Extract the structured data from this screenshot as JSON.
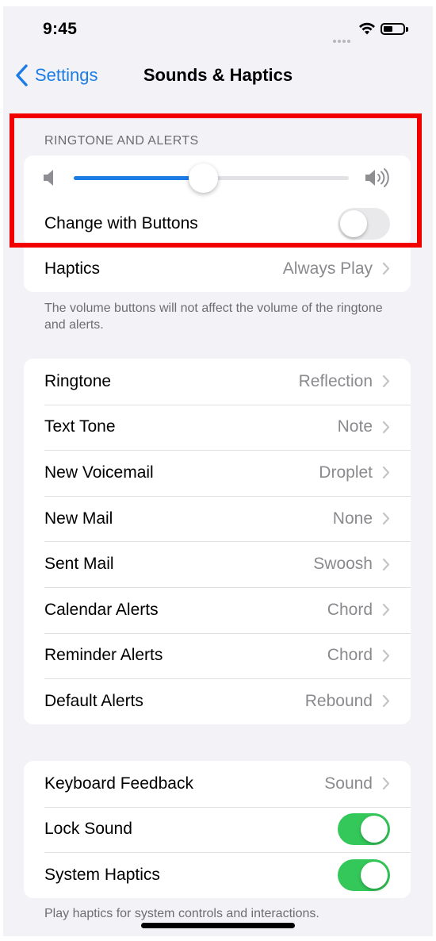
{
  "status_bar": {
    "time": "9:45"
  },
  "nav": {
    "back_label": "Settings",
    "title": "Sounds & Haptics"
  },
  "ringtone_section": {
    "header": "RINGTONE AND ALERTS",
    "volume_level": 0.47,
    "change_with_buttons_label": "Change with Buttons",
    "change_with_buttons_on": false,
    "haptics_label": "Haptics",
    "haptics_value": "Always Play",
    "footnote": "The volume buttons will not affect the volume of the ringtone and alerts."
  },
  "tones": [
    {
      "label": "Ringtone",
      "value": "Reflection"
    },
    {
      "label": "Text Tone",
      "value": "Note"
    },
    {
      "label": "New Voicemail",
      "value": "Droplet"
    },
    {
      "label": "New Mail",
      "value": "None"
    },
    {
      "label": "Sent Mail",
      "value": "Swoosh"
    },
    {
      "label": "Calendar Alerts",
      "value": "Chord"
    },
    {
      "label": "Reminder Alerts",
      "value": "Chord"
    },
    {
      "label": "Default Alerts",
      "value": "Rebound"
    }
  ],
  "system_section": {
    "keyboard_feedback_label": "Keyboard Feedback",
    "keyboard_feedback_value": "Sound",
    "lock_sound_label": "Lock Sound",
    "lock_sound_on": true,
    "system_haptics_label": "System Haptics",
    "system_haptics_on": true,
    "footnote": "Play haptics for system controls and interactions."
  },
  "colors": {
    "accent": "#1c7ce6",
    "toggle_on": "#34c759",
    "background": "#f2f2f7",
    "highlight": "#f20000"
  }
}
